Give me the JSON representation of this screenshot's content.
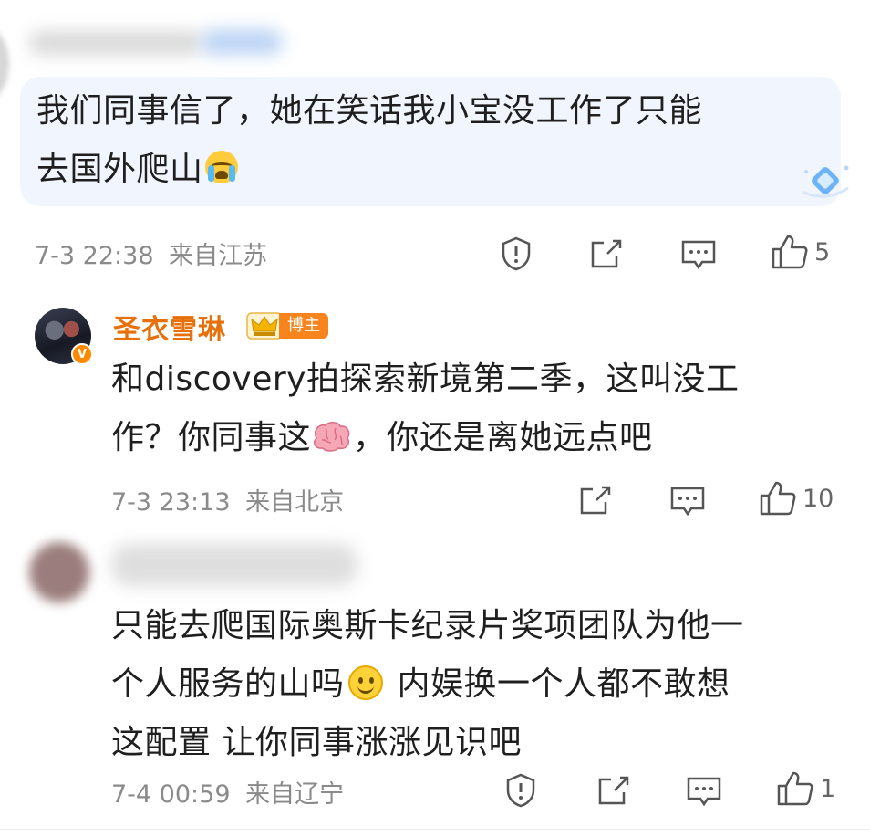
{
  "comments": [
    {
      "text_line1": "我们同事信了，她在笑话我小宝没工作了只能",
      "text_line2": "去国外爬山",
      "emoji": "loudly-crying-face",
      "timestamp": "7-3 22:38",
      "location": "来自江苏",
      "likes": "5"
    },
    {
      "username": "圣衣雪琳",
      "badge": "博主",
      "text_line1": "和discovery拍探索新境第二季，这叫没工",
      "text_line2_a": "作？你同事这",
      "text_line2_b": "，你还是离她远点吧",
      "emoji": "brain",
      "timestamp": "7-3 23:13",
      "location": "来自北京",
      "likes": "10"
    },
    {
      "text_line1": "只能去爬国际奥斯卡纪录片奖项团队为他一",
      "text_line2_a": "个人服务的山吗",
      "text_line2_b": " 内娱换一个人都不敢想",
      "text_line3": "这配置 让你同事涨涨见识吧",
      "emoji": "smile",
      "timestamp": "7-4 00:59",
      "location": "来自辽宁",
      "likes": "1"
    }
  ],
  "colors": {
    "accent_name": "#e8700a",
    "badge_bg": "#f7841c",
    "bubble_bg": "#f1f5fe",
    "meta_text": "#8a8a8a"
  }
}
